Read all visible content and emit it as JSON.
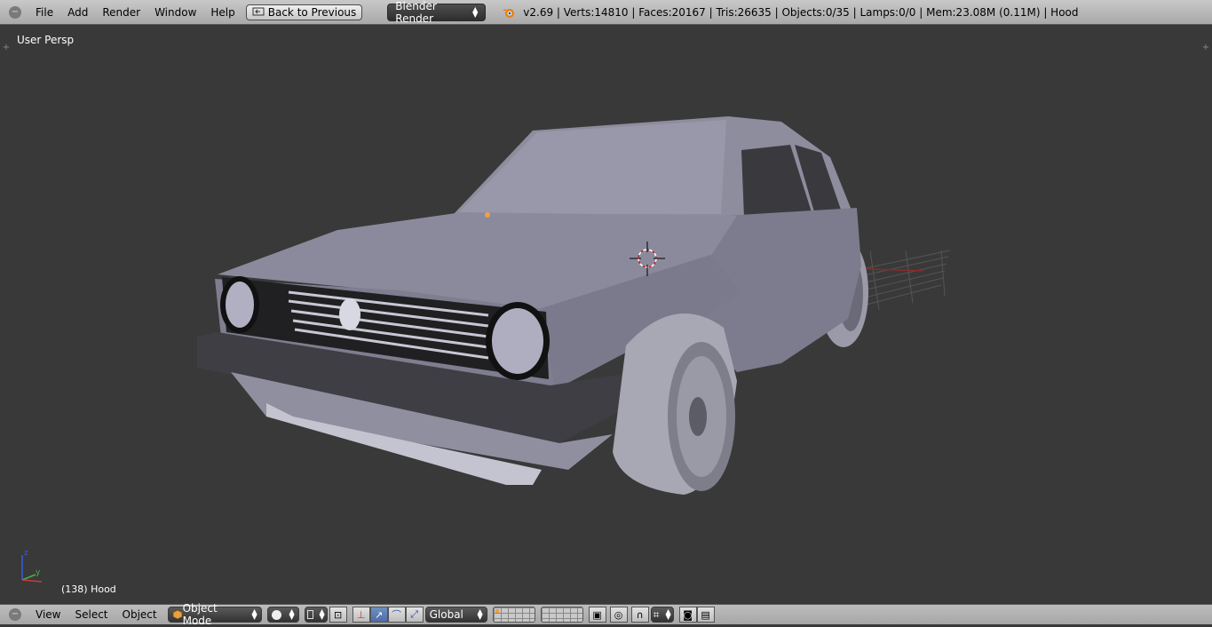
{
  "topbar": {
    "menus": [
      "File",
      "Add",
      "Render",
      "Window",
      "Help"
    ],
    "back_button": "Back to Previous",
    "render_engine": "Blender Render",
    "stats": "v2.69 | Verts:14810 | Faces:20167 | Tris:26635 | Objects:0/35 | Lamps:0/0 | Mem:23.08M (0.11M) | Hood"
  },
  "viewport": {
    "view_name": "User Persp",
    "object_info": "(138) Hood",
    "axes": {
      "x": "x",
      "y": "y",
      "z": "z"
    }
  },
  "bottombar": {
    "menus": [
      "View",
      "Select",
      "Object"
    ],
    "mode": "Object Mode",
    "orientation": "Global"
  },
  "colors": {
    "header": "#b4b4b4",
    "viewport_bg": "#393939",
    "car_body": "#8a8a9c",
    "accent_blue": "#5680c2"
  }
}
